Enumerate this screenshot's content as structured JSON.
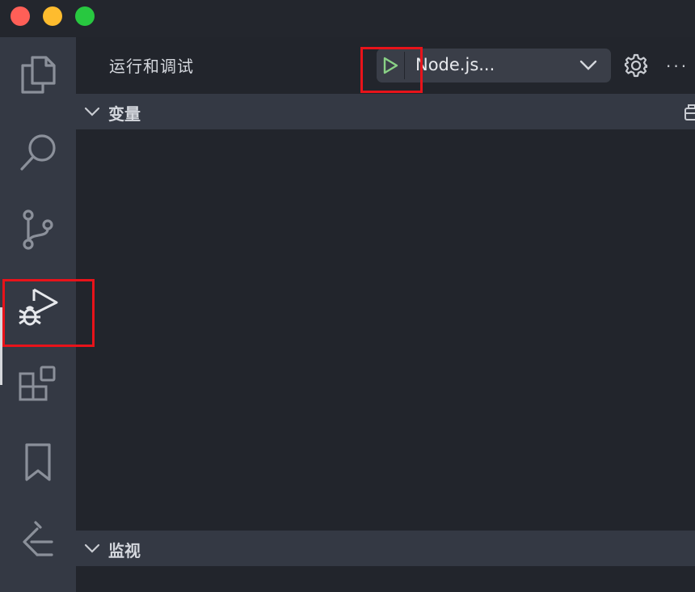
{
  "window": {
    "traffic_lights": [
      "close",
      "minimize",
      "maximize"
    ]
  },
  "activity_bar": {
    "items": [
      {
        "name": "explorer",
        "icon": "files-icon"
      },
      {
        "name": "search",
        "icon": "search-icon"
      },
      {
        "name": "source-control",
        "icon": "source-control-icon"
      },
      {
        "name": "run-and-debug",
        "icon": "run-debug-icon",
        "active": true
      },
      {
        "name": "extensions",
        "icon": "extensions-icon"
      },
      {
        "name": "bookmarks",
        "icon": "bookmark-icon"
      },
      {
        "name": "gitlens",
        "icon": "gitlens-icon"
      }
    ]
  },
  "sidebar": {
    "title": "运行和调试",
    "launch_config": {
      "selected": "Node.js...",
      "play_icon": "play-icon",
      "dropdown_icon": "chevron-down-icon"
    },
    "toolbar": {
      "settings_icon": "gear-icon",
      "more_label": "···"
    },
    "sections": {
      "variables": {
        "title": "变量",
        "expanded": true
      },
      "watch": {
        "title": "监视",
        "expanded": true
      }
    }
  },
  "colors": {
    "accent_play": "#89d185",
    "highlight": "#e8131a",
    "activity_bar_bg": "#343944",
    "sidebar_bg": "#22252c"
  }
}
